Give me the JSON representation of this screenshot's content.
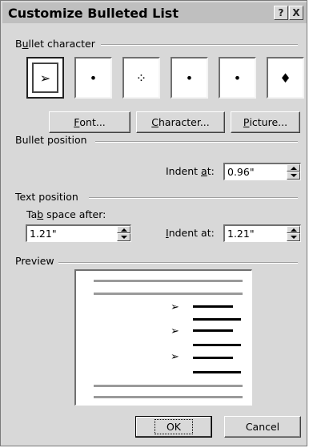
{
  "title": "Customize Bulleted List",
  "title_buttons": {
    "help": "?",
    "close": "X"
  },
  "bullet_character": {
    "label_prefix": "B",
    "label_underlined": "u",
    "label_suffix": "llet character",
    "glyphs": [
      "➢",
      "•",
      "⁘",
      "•",
      "•",
      "♦"
    ],
    "selected_index": 0
  },
  "buttons": {
    "font_underlined": "F",
    "font_rest": "ont...",
    "character_underlined": "C",
    "character_rest": "haracter...",
    "picture_underlined": "P",
    "picture_rest": "icture...",
    "ok": "OK",
    "cancel": "Cancel"
  },
  "bullet_position": {
    "label": "Bullet position",
    "indent_prefix": "Indent ",
    "indent_underlined": "a",
    "indent_suffix": "t:",
    "indent_value": "0.96\""
  },
  "text_position": {
    "label": "Text position",
    "tab_prefix": "Ta",
    "tab_underlined": "b",
    "tab_suffix": " space after:",
    "tab_value": "1.21\"",
    "indent_prefix": "",
    "indent_underlined": "I",
    "indent_suffix": "ndent at:",
    "indent_value": "1.21\""
  },
  "preview": {
    "label": "Preview",
    "bullet_glyph": "➢"
  }
}
